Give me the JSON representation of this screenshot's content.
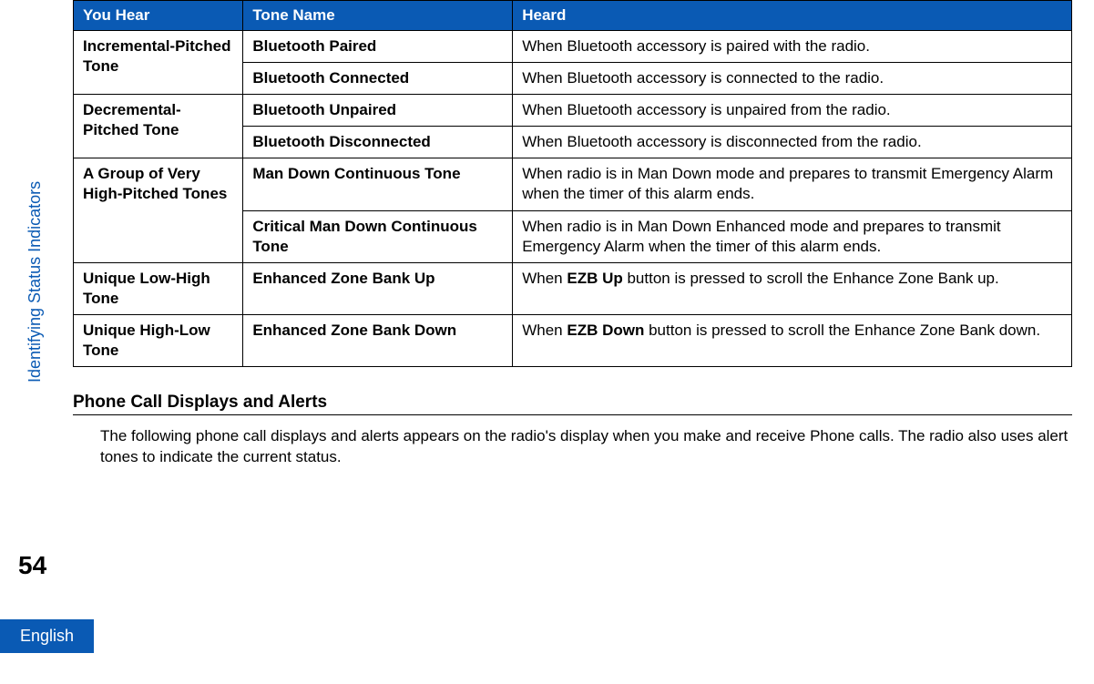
{
  "side_label": "Identifying Status Indicators",
  "page_number": "54",
  "language_tab": "English",
  "table": {
    "headers": [
      "You Hear",
      "Tone Name",
      "Heard"
    ],
    "groups": [
      {
        "label": "Incremental-Pitched Tone",
        "rows": [
          {
            "tone": "Bluetooth Paired",
            "heard": "When Bluetooth accessory is paired with the radio."
          },
          {
            "tone": "Bluetooth Connected",
            "heard": "When Bluetooth accessory is connected to the radio."
          }
        ]
      },
      {
        "label": "Decremental-Pitched Tone",
        "rows": [
          {
            "tone": "Bluetooth Unpaired",
            "heard": "When Bluetooth accessory is unpaired from the radio."
          },
          {
            "tone": "Bluetooth Disconnected",
            "heard": "When Bluetooth accessory is disconnected from the radio."
          }
        ]
      },
      {
        "label": "A Group of Very High-Pitched Tones",
        "rows": [
          {
            "tone": "Man Down Continuous Tone",
            "heard": "When radio is in Man Down mode and prepares to transmit Emergency Alarm when the timer of this alarm ends."
          },
          {
            "tone": "Critical Man Down Continuous Tone",
            "heard": "When radio is in Man Down Enhanced mode and prepares to transmit Emergency Alarm when the timer of this alarm ends."
          }
        ]
      },
      {
        "label": "Unique Low-High Tone",
        "rows": [
          {
            "tone": "Enhanced Zone Bank Up",
            "heard_pre": "When ",
            "heard_bold": "EZB Up",
            "heard_post": " button is pressed to scroll the Enhance Zone Bank up."
          }
        ]
      },
      {
        "label": "Unique High-Low Tone",
        "rows": [
          {
            "tone": "Enhanced Zone Bank Down",
            "heard_pre": "When ",
            "heard_bold": "EZB Down",
            "heard_post": " button is pressed to scroll the Enhance Zone Bank down."
          }
        ]
      }
    ]
  },
  "section": {
    "title": "Phone Call Displays and Alerts",
    "body": "The following phone call displays and alerts appears on the radio's display when you make and receive Phone calls. The radio also uses alert tones to indicate the current status."
  }
}
